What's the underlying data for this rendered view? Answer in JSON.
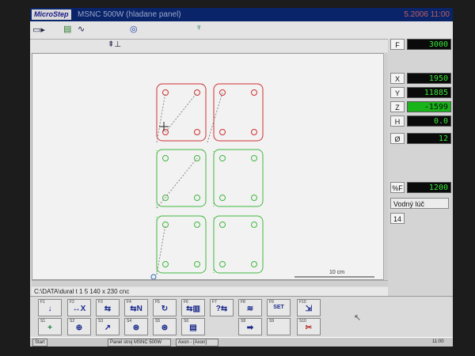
{
  "titlebar": {
    "logo": "MicroStep",
    "title": "MSNC 500W (hladane panel)",
    "clock": "5.2006 11:00"
  },
  "toolbar": {
    "icon1": "pause-play-icon",
    "icon2": "program-icon",
    "icon3": "wave-icon",
    "icon4": "target-icon",
    "icon5": "torch-icon",
    "icon6": "height-icon"
  },
  "canvas": {
    "scale_label": "10 cm"
  },
  "status": {
    "path": "C:\\DATA\\dural t 1 5 140 x 230 cnc"
  },
  "panel": {
    "F": {
      "label": "F",
      "value": "3000"
    },
    "X": {
      "label": "X",
      "value": "1950"
    },
    "Y": {
      "label": "Y",
      "value": "11885"
    },
    "Z": {
      "label": "Z",
      "value": "-1599"
    },
    "H": {
      "label": "H",
      "value": "0.0"
    },
    "D": {
      "label": "Ø",
      "value": "12"
    },
    "PF": {
      "label": "%F",
      "value": "1200"
    },
    "mode": "Vodný lúč",
    "mode_number": "14"
  },
  "fkeys": {
    "f1": {
      "key": "F1",
      "icon": "↓"
    },
    "f2": {
      "key": "F2",
      "icon": "↔X"
    },
    "f3": {
      "key": "F3",
      "icon": "⇆"
    },
    "f4": {
      "key": "F4",
      "icon": "⇆N"
    },
    "f5": {
      "key": "F5",
      "icon": "↻"
    },
    "f6": {
      "key": "F6",
      "icon": "⇆▥"
    },
    "f7": {
      "key": "F7",
      "icon": "?⇆"
    },
    "f8": {
      "key": "F8",
      "icon": "≋"
    },
    "f9": {
      "key": "F9",
      "icon": "SET"
    },
    "f10": {
      "key": "F10",
      "icon": "⇲"
    },
    "s1": {
      "key": "S1",
      "icon": "+"
    },
    "s2": {
      "key": "S2",
      "icon": "⊕"
    },
    "s3": {
      "key": "S3",
      "icon": "↗"
    },
    "s4": {
      "key": "S4",
      "icon": "⊛"
    },
    "s5": {
      "key": "S5",
      "icon": "⊛"
    },
    "s6": {
      "key": "S6",
      "icon": "▤"
    },
    "s7": {
      "key": "S7",
      "icon": ""
    },
    "s8": {
      "key": "S8",
      "icon": "➡"
    },
    "s9": {
      "key": "S9",
      "icon": ""
    },
    "s10": {
      "key": "S10",
      "icon": "✂"
    }
  },
  "taskbar": {
    "start": "Start",
    "task1": "Panel stroj MSNC 500W",
    "task2": "Axon - [Axon]",
    "tray_time": "11:00"
  }
}
